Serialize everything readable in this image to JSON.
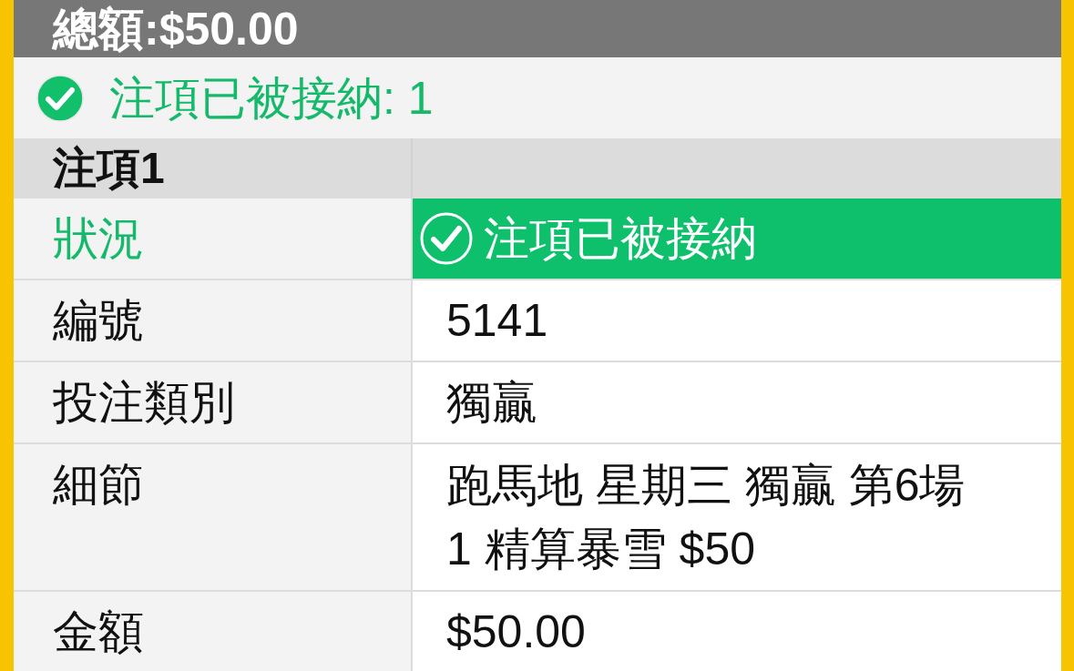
{
  "summary": {
    "total": "總額:$50.00"
  },
  "status_banner": {
    "text": "注項已被接納: 1",
    "accepted": true
  },
  "bets": [
    {
      "title": "注項1",
      "rows": [
        {
          "kind": "status",
          "label": "狀況",
          "value": "注項已被接納",
          "accepted": true
        },
        {
          "kind": "text",
          "label": "編號",
          "value": "5141"
        },
        {
          "kind": "text",
          "label": "投注類別",
          "value": "獨贏"
        },
        {
          "kind": "lines",
          "label": "細節",
          "lines": [
            "跑馬地 星期三 獨贏 第6場",
            "1 精算暴雪 $50"
          ]
        },
        {
          "kind": "text",
          "label": "金額",
          "value": "$50.00"
        }
      ]
    }
  ]
}
